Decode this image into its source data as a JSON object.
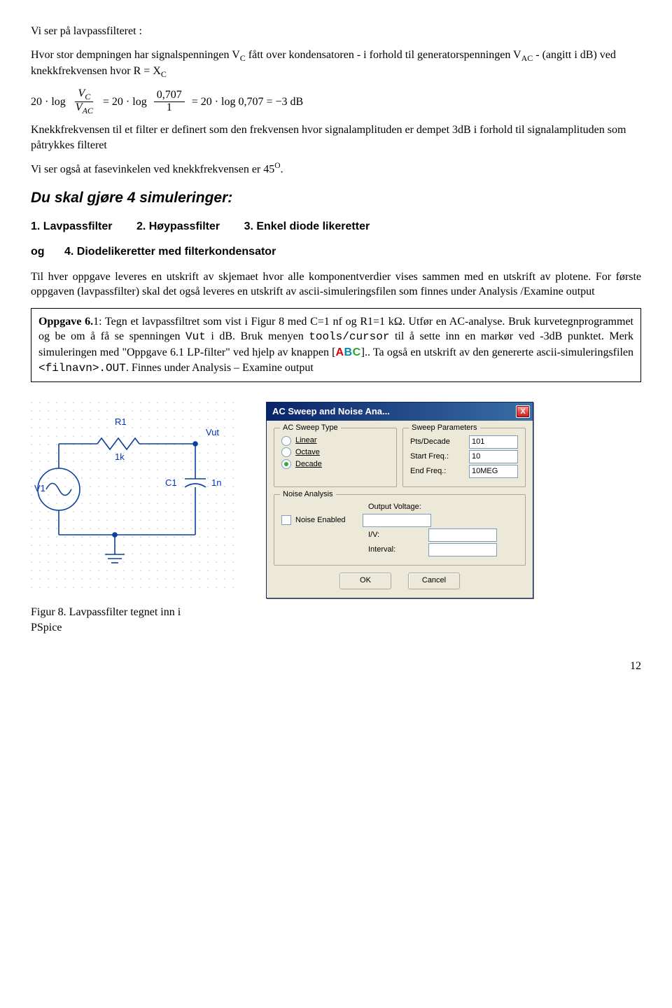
{
  "intro": {
    "line1": "Vi ser på lavpassfilteret :",
    "para1_a": "Hvor stor dempningen har signalspenningen V",
    "para1_b": " fått over kondensatoren - i forhold til generatorspenningen V",
    "para1_c": " - (angitt i dB) ved knekkfrekvensen hvor R = X",
    "sub_c": "C",
    "sub_ac": "AC",
    "eq_left": "20 · log",
    "eq_mid1": " = 20 · log",
    "eq_mid2": " = 20 · log 0,707 = −3 dB",
    "frac1_num": "V",
    "frac1_den": "V",
    "frac2_num": "0,707",
    "frac2_den": "1",
    "para2": "Knekkfrekvensen til et filter er definert som den frekvensen hvor signalamplituden er dempet 3dB i forhold til signalamplituden som påtrykkes filteret",
    "para3_a": "Vi ser også at fasevinkelen ved knekkfrekvensen er 45",
    "para3_sup": "O",
    "para3_b": "."
  },
  "heading": "Du skal gjøre 4 simuleringer:",
  "sim_line": {
    "c1": "1. Lavpassfilter",
    "c2": "2. Høypassfilter",
    "c3": "3. Enkel diode likeretter"
  },
  "sim_line2": {
    "og": "og",
    "c4": "4. Diodelikeretter med filterkondensator"
  },
  "para4": "Til hver oppgave leveres en utskrift av skjemaet hvor alle komponentverdier vises sammen med en utskrift av plotene.  For første oppgaven (lavpassfilter) skal det også leveres en utskrift av ascii-simuleringsfilen som finnes under Analysis /Examine output",
  "box": {
    "t1_a": "Oppgave 6.",
    "t1_b": "1",
    "t1_c": ": Tegn et lavpassfiltret som vist i Figur 8 med C=1 nf og R1=1 kΩ. Utfør en AC-analyse. Bruk kurvetegnprogrammet og be om å få se spenningen ",
    "vut": "Vut",
    "t1_d": " i dB.  Bruk menyen ",
    "menu": "tools/cursor",
    "t1_e": " til å sette inn en markør ved -3dB punktet. Merk simuleringen med \"Oppgave 6.1 LP-filter\" ved hjelp av knappen [",
    "abc_a": "A",
    "abc_b": "B",
    "abc_c": "C",
    "t1_f": "]..  Ta også en utskrift av den genererte ascii-simuleringsfilen ",
    "fil": "<filnavn>.OUT",
    "t1_g": ".  Finnes under Analysis – Examine output"
  },
  "circuit": {
    "r1": "R1",
    "r1v": "1k",
    "v1": "V1",
    "c1": "C1",
    "c1v": "1n",
    "vut": "Vut"
  },
  "dialog": {
    "title": "AC Sweep and Noise Ana...",
    "close": "X",
    "fs_sweeptype": "AC Sweep Type",
    "r_linear": "Linear",
    "r_octave": "Octave",
    "r_decade": "Decade",
    "fs_sweepparams": "Sweep Parameters",
    "p_pts": "Pts/Decade",
    "p_pts_v": "101",
    "p_start": "Start Freq.:",
    "p_start_v": "10",
    "p_end": "End Freq.:",
    "p_end_v": "10MEG",
    "fs_noise": "Noise Analysis",
    "chk_noise": "Noise Enabled",
    "lbl_outv": "Output Voltage:",
    "lbl_iv": "I/V:",
    "lbl_interval": "Interval:",
    "btn_ok": "OK",
    "btn_cancel": "Cancel"
  },
  "figcap": "Figur 8. Lavpassfilter tegnet inn i PSpice",
  "pagenum": "12"
}
